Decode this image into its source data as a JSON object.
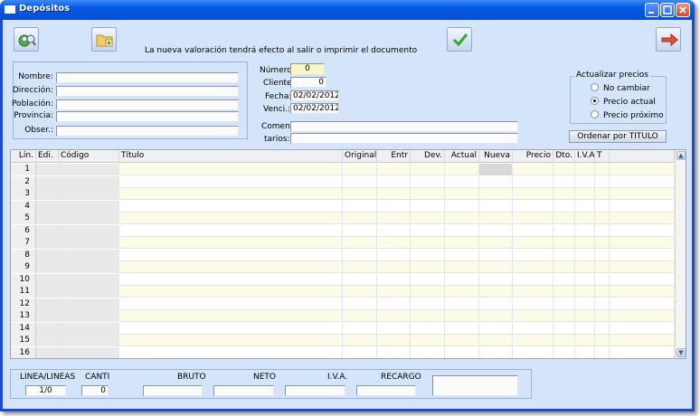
{
  "window": {
    "title": "Depósitos"
  },
  "toolbar": {
    "message": "La nueva valoración tendrá efecto al salir o imprimir el documento",
    "icons": [
      "search-person-icon",
      "new-folder-icon",
      "accept-check-icon",
      "exit-arrow-icon"
    ]
  },
  "client": {
    "nombre_label": "Nombre:",
    "nombre": "",
    "direccion_label": "Dirección:",
    "direccion": "",
    "poblacion_label": "Población:",
    "poblacion": "",
    "provincia_label": "Provincia:",
    "provincia": "",
    "obser_label": "Obser.:",
    "obser": ""
  },
  "doc": {
    "numero_label": "Número:",
    "numero": "0",
    "cliente_label": "Cliente:",
    "cliente": "0",
    "fecha_label": "Fecha:",
    "fecha": "02/02/2012",
    "venci_label": "Venci.:",
    "venci": "02/02/2012",
    "comen_label": "Comen-",
    "tarios_label": "tarios:",
    "comentarios_1": "",
    "comentarios_2": ""
  },
  "prices": {
    "title": "Actualizar precios",
    "options": [
      "No cambiar",
      "Precio actual",
      "Precio próximo"
    ],
    "selected": "Precio actual",
    "sort_button": "Ordenar por TITULO"
  },
  "grid": {
    "columns": [
      "Lín.",
      "Edi.",
      "Código",
      "Título",
      "Original",
      "Entr",
      "Dev.",
      "Actual",
      "Nueva",
      "Precio",
      "Dto.",
      "I.V.A.",
      "T"
    ],
    "rows": [
      "1",
      "2",
      "3",
      "4",
      "5",
      "6",
      "7",
      "8",
      "9",
      "10",
      "11",
      "12",
      "13",
      "14",
      "15",
      "16"
    ]
  },
  "totals": {
    "linea_label": "LINEA/LINEAS",
    "linea": "1/0",
    "canti_label": "CANTI",
    "canti": "0",
    "bruto_label": "BRUTO",
    "bruto": "",
    "neto_label": "NETO",
    "neto": "",
    "iva_label": "I.V.A.",
    "iva": "",
    "recargo_label": "RECARGO",
    "recargo": "",
    "total": ""
  },
  "colors": {
    "window_bg": "#d4e4fb",
    "titlebar": "#0453dc",
    "grid_bg": "#fffff4",
    "highlight_field": "#fbf6c6"
  }
}
